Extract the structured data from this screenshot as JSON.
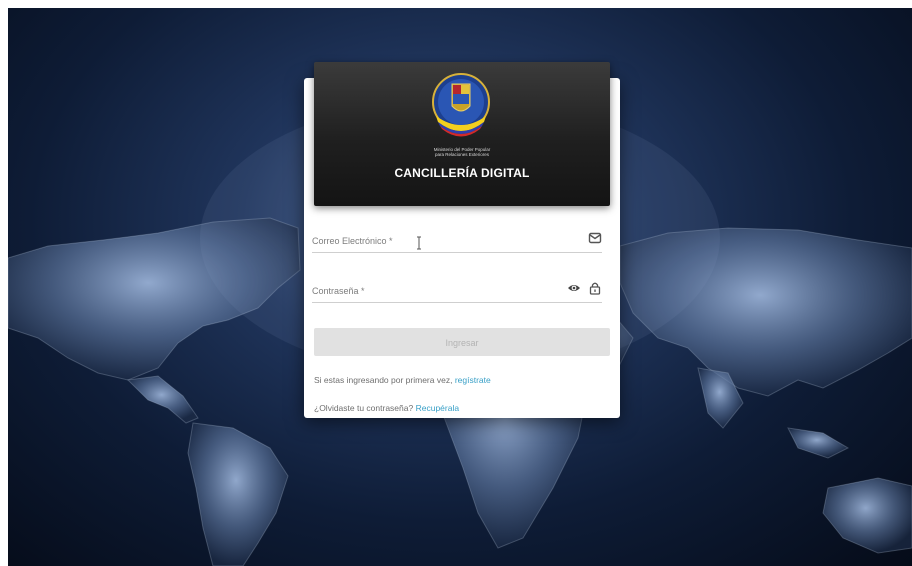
{
  "header": {
    "ministry_text": "Ministerio del Poder Popular\npara Relaciones Exteriores",
    "title": "CANCILLERÍA DIGITAL"
  },
  "form": {
    "email_label": "Correo Electrónico *",
    "password_label": "Contraseña *",
    "submit_label": "Ingresar",
    "submit_enabled": false
  },
  "links": {
    "register_prefix": "Si estas ingresando por primera vez,",
    "register_link": "regístrate",
    "recover_prefix": "¿Olvidaste tu contraseña?",
    "recover_link": "Recupérala"
  },
  "icons": {
    "email": "envelope-icon",
    "password_visibility": "eye-icon",
    "password_lock": "lock-icon"
  },
  "colors": {
    "link": "#39a0c7",
    "button_disabled": "#e1e1e1",
    "header_bg": "#1f1f1f",
    "background": "#0e1c36"
  }
}
